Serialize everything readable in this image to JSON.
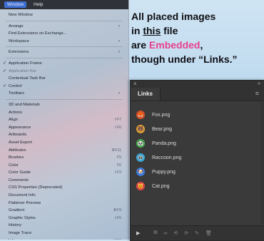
{
  "menu_bar": {
    "items": [
      "Window",
      "Help"
    ]
  },
  "window_menu": {
    "items": [
      {
        "label": "New Window"
      },
      {
        "sep": true
      },
      {
        "label": "Arrange",
        "chevron": true
      },
      {
        "label": "Find Extensions on Exchange..."
      },
      {
        "label": "Workspace",
        "chevron": true
      },
      {
        "sep": true
      },
      {
        "label": "Extensions",
        "chevron": true
      },
      {
        "sep": true
      },
      {
        "label": "Application Frame",
        "check": true
      },
      {
        "label": "Application Bar",
        "check": true,
        "disabled": true
      },
      {
        "label": "Contextual Task Bar"
      },
      {
        "label": "Control",
        "check": true
      },
      {
        "label": "Toolbars",
        "chevron": true
      },
      {
        "sep": true
      },
      {
        "label": "3D and Materials"
      },
      {
        "label": "Actions"
      },
      {
        "label": "Align",
        "shortcut": "⇧F7"
      },
      {
        "label": "Appearance",
        "shortcut": "⇧F6"
      },
      {
        "label": "Artboards"
      },
      {
        "label": "Asset Export"
      },
      {
        "label": "Attributes",
        "shortcut": "⌘F11"
      },
      {
        "label": "Brushes",
        "shortcut": "F5"
      },
      {
        "label": "Color",
        "shortcut": "F6"
      },
      {
        "label": "Color Guide",
        "shortcut": "⇧F3"
      },
      {
        "label": "Comments"
      },
      {
        "label": "CSS Properties (Deprecated)"
      },
      {
        "label": "Document Info"
      },
      {
        "label": "Flattener Preview"
      },
      {
        "label": "Gradient",
        "shortcut": "⌘F9"
      },
      {
        "label": "Graphic Styles",
        "shortcut": "⇧F5"
      },
      {
        "label": "History"
      },
      {
        "label": "Image Trace"
      },
      {
        "label": "Info",
        "shortcut": "⌘F8"
      },
      {
        "label": "Layers",
        "shortcut": "F7"
      }
    ]
  },
  "callout": {
    "line1": "All placed images",
    "line2_pre": "in ",
    "line2_underline": "this",
    "line2_post": " file",
    "line3_pre": "are ",
    "line3_pink": "Embedded",
    "line3_post": ",",
    "line4": "though under “Links.”"
  },
  "links_panel": {
    "close_icon": "×",
    "collapse_icon": "»",
    "tab_label": "Links",
    "menu_icon": "≡",
    "items": [
      {
        "name": "Fox.png",
        "icon": "fox-icon",
        "color": "#d9532a",
        "glyph": "🦊"
      },
      {
        "name": "Bear.png",
        "icon": "bear-icon",
        "color": "#e0a030",
        "glyph": "🐻"
      },
      {
        "name": "Panda.png",
        "icon": "panda-icon",
        "color": "#4caf50",
        "glyph": "🐼"
      },
      {
        "name": "Raccoon.png",
        "icon": "raccoon-icon",
        "color": "#3aa7d6",
        "glyph": "🦝"
      },
      {
        "name": "Puppy.png",
        "icon": "puppy-icon",
        "color": "#3b7ddd",
        "glyph": "🐶"
      },
      {
        "name": "Cat.png",
        "icon": "cat-icon",
        "color": "#e04848",
        "glyph": "🐱"
      }
    ],
    "footer": {
      "expand_icon": "▶",
      "tools": [
        "⧉",
        "∞",
        "⟲",
        "⟳",
        "✎",
        "🗑"
      ]
    }
  },
  "colors": {
    "accent_pink": "#ea3f8e",
    "panel_bg": "#3a3a3a",
    "menu_highlight": "#3d6fd6"
  }
}
